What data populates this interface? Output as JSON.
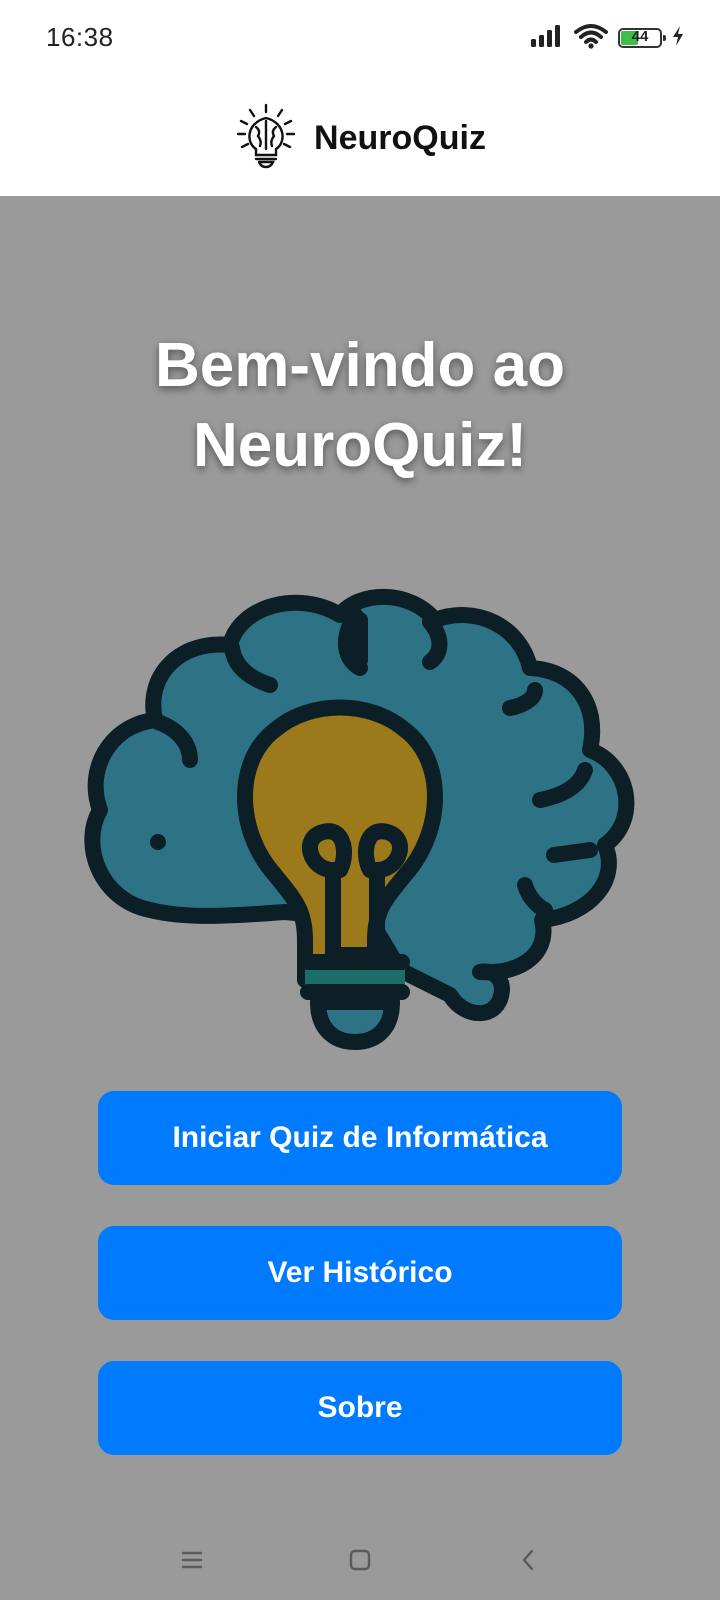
{
  "status_bar": {
    "time": "16:38",
    "battery_level": "44",
    "battery_fraction": 0.44,
    "icons": [
      "signal-icon",
      "wifi-icon",
      "battery-icon",
      "charging-icon"
    ]
  },
  "header": {
    "logo_icon": "brain-lightbulb-icon",
    "title": "NeuroQuiz"
  },
  "main": {
    "welcome_title": "Bem-vindo ao NeuroQuiz!",
    "hero_image": "brain-lightbulb-illustration",
    "buttons": [
      {
        "label": "Iniciar Quiz de Informática"
      },
      {
        "label": "Ver Histórico"
      },
      {
        "label": "Sobre"
      }
    ]
  },
  "nav_bar": {
    "icons": [
      "menu-icon",
      "home-icon",
      "back-icon"
    ]
  },
  "colors": {
    "background": "#9a9a9a",
    "header_background": "#ffffff",
    "button": "#007aff",
    "button_text": "#ffffff",
    "brain": "#2e7385",
    "bulb": "#9c7a1c",
    "outline": "#0c1f26"
  }
}
